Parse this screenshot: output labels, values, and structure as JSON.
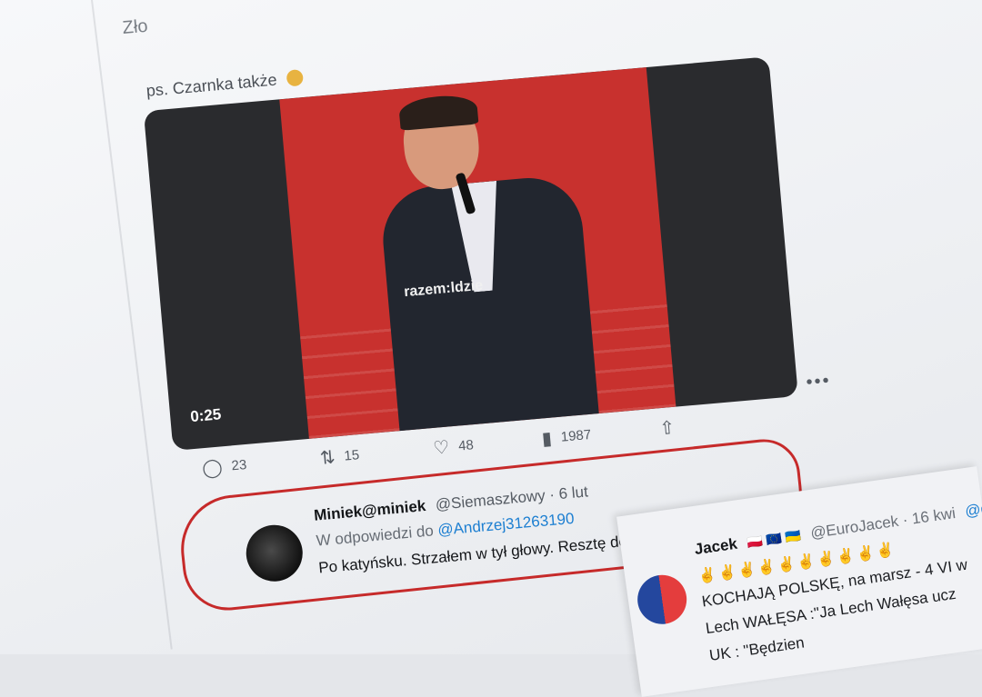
{
  "top_cut_text": "Zło",
  "tweet": {
    "ps_text": "ps. Czarnka także",
    "video": {
      "duration": "0:25",
      "jacket_text": "razem:ldzie"
    },
    "actions": {
      "replies": "23",
      "retweets": "15",
      "likes": "48",
      "views": "1987"
    }
  },
  "reply": {
    "name": "Miniek@miniek",
    "handle": "@Siemaszkowy · 6 lut",
    "reply_to_label": "W odpowiedzi do",
    "reply_to_mention": "@Andrzej31263190",
    "text": "Po katyńsku. Strzałem w tył głowy. Resztę dobić w Smoleńsku."
  },
  "second_tweet": {
    "name": "Jacek",
    "flags": "🇵🇱 🇪🇺 🇺🇦",
    "handle": "@EuroJacek · 16 kwi",
    "mention": "@donald",
    "line1": "KOCHAJĄ POLSKĘ,  na marsz - 4 VI w",
    "line2": "Lech WAŁĘSA :\"Ja Lech Wałęsa ucz",
    "line3": "UK : \"Będzien"
  },
  "colors": {
    "circle": "#c62a2a",
    "mention": "#1d7fd1",
    "stage_red": "#c8312e"
  }
}
